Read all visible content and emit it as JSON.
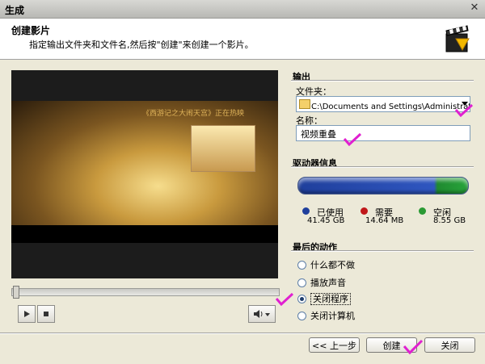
{
  "window": {
    "title": "生成"
  },
  "header": {
    "title": "创建影片",
    "subtitle": "指定输出文件夹和文件名,然后按\"创建\"来创建一个影片。"
  },
  "preview": {
    "caption": "《西游记之大闹天宫》正在热映",
    "seek_progress": 0.0
  },
  "output": {
    "section_title": "输出",
    "folder_label": "文件夹：",
    "folder_value": "C:\\Documents and Settings\\Administrator\\桌面",
    "name_label": "名称：",
    "name_value": "视频重叠"
  },
  "drive": {
    "section_title": "驱动器信息",
    "used_label": "已使用",
    "used_value": "41.45 GB",
    "needed_label": "需要",
    "needed_value": "14.64 MB",
    "free_label": "空闲",
    "free_value": "8.55 GB",
    "colors": {
      "used": "#1f3f9c",
      "needed": "#c0181a",
      "free": "#2a9a34"
    }
  },
  "final_action": {
    "section_title": "最后的动作",
    "options": [
      "什么都不做",
      "播放声音",
      "关闭程序",
      "关闭计算机"
    ],
    "selected": "关闭程序"
  },
  "buttons": {
    "back": "<< 上一步",
    "create": "创建",
    "close": "关闭"
  },
  "icons": [
    "close-icon",
    "clapperboard-icon",
    "play-icon",
    "stop-icon",
    "volume-icon",
    "folder-icon",
    "dropdown-arrow-icon"
  ]
}
